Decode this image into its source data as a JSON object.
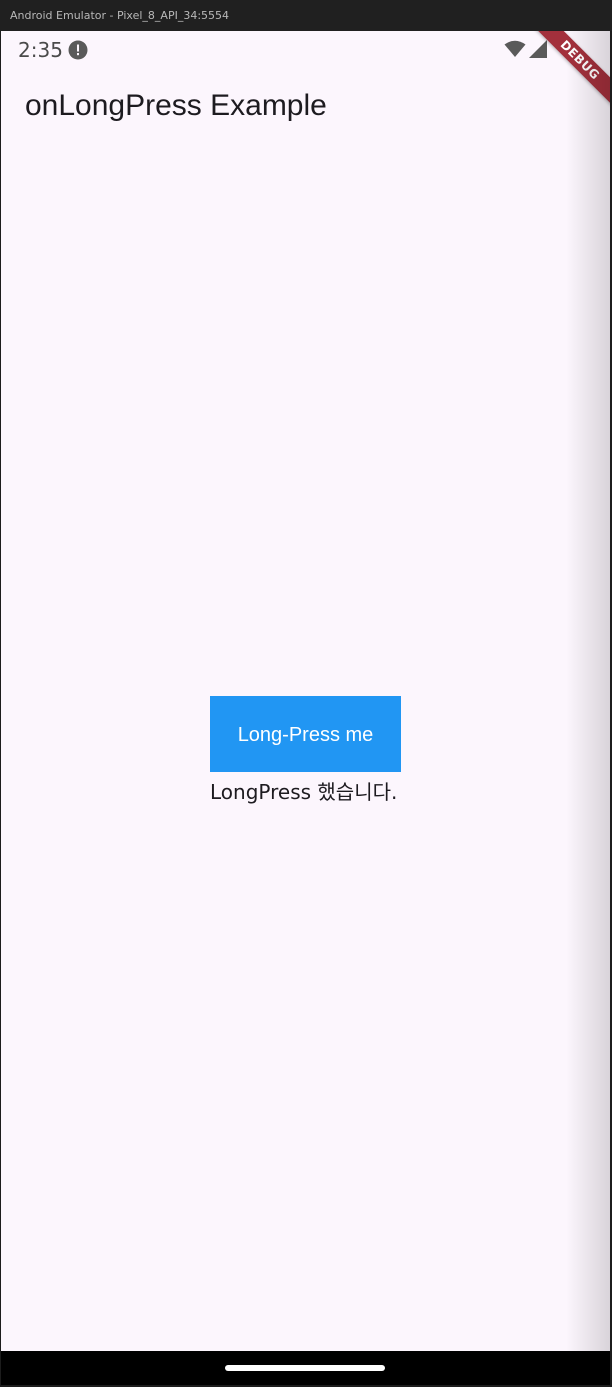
{
  "window": {
    "title": "Android Emulator - Pixel_8_API_34:5554"
  },
  "status_bar": {
    "time": "2:35",
    "icons": [
      "alert-icon",
      "wifi-icon",
      "signal-icon"
    ]
  },
  "debug_banner": {
    "label": "DEBUG"
  },
  "app_bar": {
    "title": "onLongPress Example"
  },
  "main": {
    "button_label": "Long-Press me",
    "result_text": "LongPress 했습니다."
  },
  "colors": {
    "background": "#fcf6fd",
    "button": "#2196f3",
    "debug_banner": "#a3303c"
  }
}
